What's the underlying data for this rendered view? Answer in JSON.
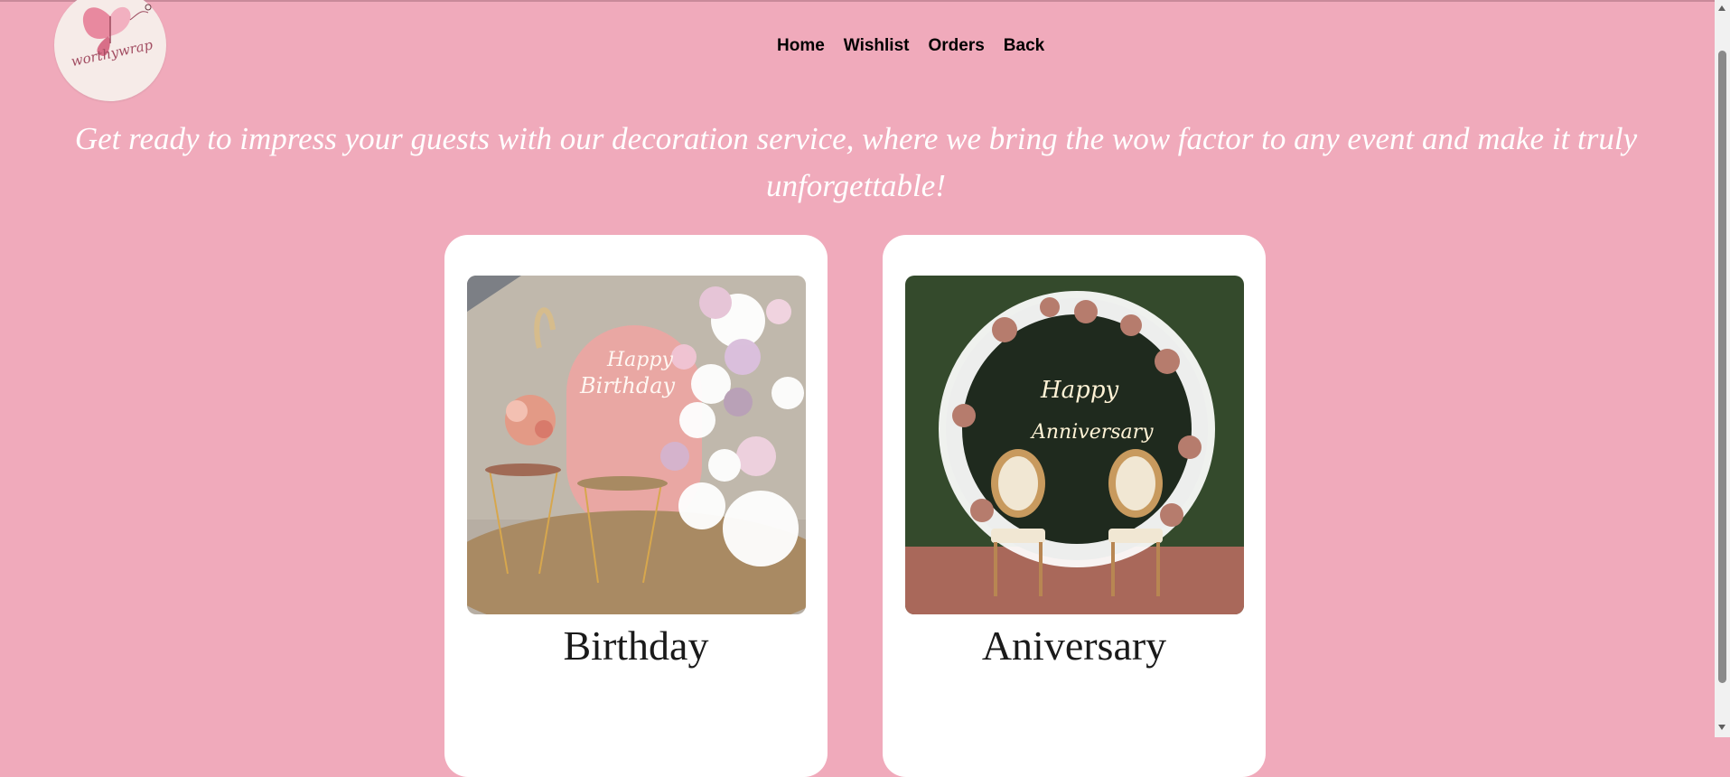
{
  "brand": {
    "logo_text": "worthywrap"
  },
  "nav": {
    "items": [
      "Home",
      "Wishlist",
      "Orders",
      "Back"
    ]
  },
  "tagline": "Get ready to impress your guests with our decoration service, where we bring the wow factor to any event and make it truly unforgettable!",
  "cards": [
    {
      "label": "Birthday",
      "image_sign": [
        "Happy",
        "Birthday"
      ]
    },
    {
      "label": "Aniversary",
      "image_sign": [
        "Happy",
        "Anniversary"
      ]
    }
  ],
  "colors": {
    "page_background": "#f0aabb",
    "card_background": "#ffffff",
    "tagline_color": "#ffffff"
  }
}
